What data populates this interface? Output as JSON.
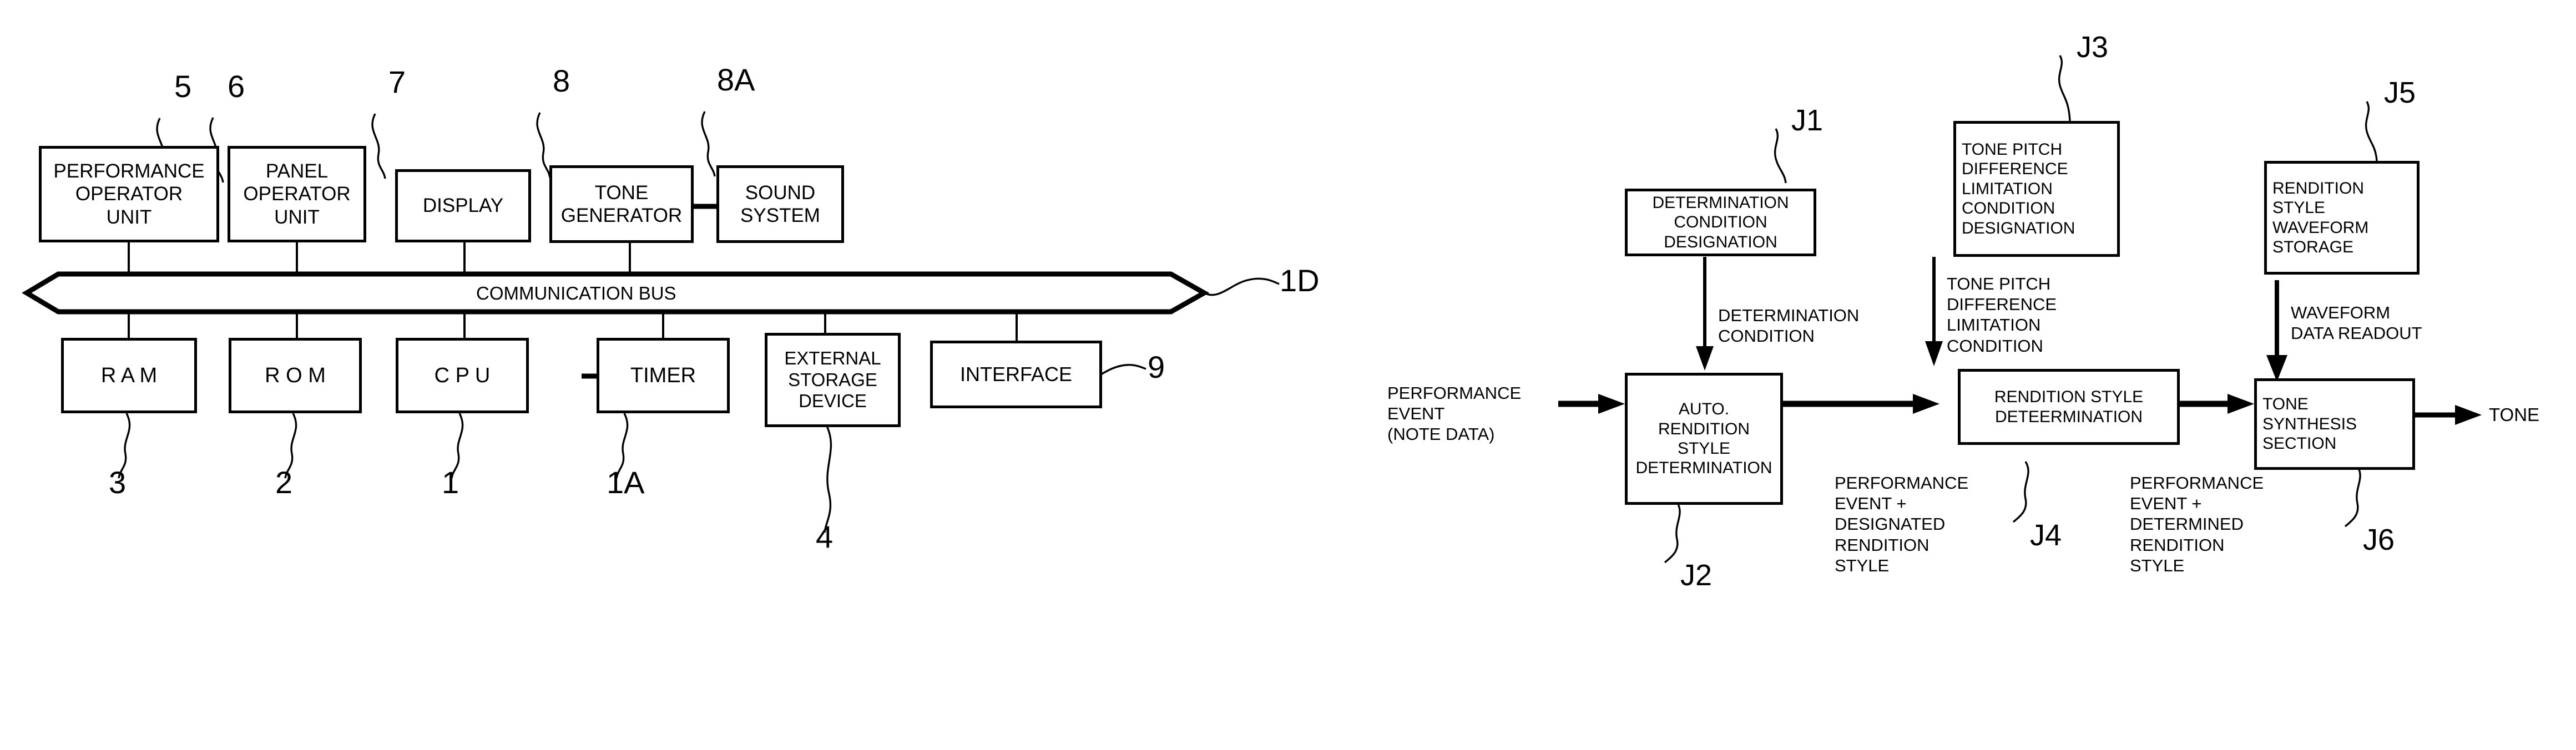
{
  "figure_left": {
    "id": "fig-1-hardware-block-diagram",
    "bus": {
      "label": "COMMUNICATION BUS",
      "ref": "1D"
    },
    "top_row": [
      {
        "lines": [
          "PERFORMANCE",
          "OPERATOR",
          "UNIT"
        ],
        "ref": "5"
      },
      {
        "lines": [
          "PANEL",
          "OPERATOR",
          "UNIT"
        ],
        "ref": "6"
      },
      {
        "lines": [
          "DISPLAY"
        ],
        "ref": "7"
      },
      {
        "lines": [
          "TONE",
          "GENERATOR"
        ],
        "ref": "8"
      },
      {
        "lines": [
          "SOUND",
          "SYSTEM"
        ],
        "ref": "8A"
      }
    ],
    "bottom_row": [
      {
        "lines": [
          "R A M"
        ],
        "ref": "3"
      },
      {
        "lines": [
          "R O M"
        ],
        "ref": "2"
      },
      {
        "lines": [
          "C P U"
        ],
        "ref": "1"
      },
      {
        "lines": [
          "TIMER"
        ],
        "ref": "1A"
      },
      {
        "lines": [
          "EXTERNAL",
          "STORAGE",
          "DEVICE"
        ],
        "ref": "4"
      },
      {
        "lines": [
          "INTERFACE"
        ],
        "ref": "9"
      }
    ]
  },
  "figure_right": {
    "id": "fig-2-functional-flow-diagram",
    "input_label": {
      "lines": [
        "PERFORMANCE",
        "EVENT",
        "(NOTE DATA)"
      ]
    },
    "output_label": "TONE",
    "boxes": [
      {
        "key": "j1",
        "lines": [
          "DETERMINATION",
          "CONDITION",
          "DESIGNATION"
        ],
        "ref": "J1",
        "align": "center"
      },
      {
        "key": "j3",
        "lines": [
          "TONE PITCH",
          "DIFFERENCE",
          "LIMITATION",
          "CONDITION",
          "DESIGNATION"
        ],
        "ref": "J3",
        "align": "left"
      },
      {
        "key": "j5",
        "lines": [
          "RENDITION",
          "STYLE",
          "WAVEFORM",
          "STORAGE"
        ],
        "ref": "J5",
        "align": "left"
      },
      {
        "key": "j2",
        "lines": [
          "AUTO.",
          "RENDITION",
          "STYLE",
          "DETERMINATION"
        ],
        "ref": "J2",
        "align": "center"
      },
      {
        "key": "j4",
        "lines": [
          "RENDITION STYLE",
          "DETEERMINATION"
        ],
        "ref": "J4",
        "align": "center"
      },
      {
        "key": "j6",
        "lines": [
          "TONE",
          "SYNTHESIS",
          "SECTION"
        ],
        "ref": "J6",
        "align": "left"
      }
    ],
    "edge_labels": [
      {
        "key": "determination_condition",
        "lines": [
          "DETERMINATION",
          "CONDITION"
        ]
      },
      {
        "key": "tone_pitch_difference_limitation_condition",
        "lines": [
          "TONE PITCH",
          "DIFFERENCE",
          "LIMITATION",
          "CONDITION"
        ]
      },
      {
        "key": "waveform_data_readout",
        "lines": [
          "WAVEFORM",
          "DATA READOUT"
        ]
      },
      {
        "key": "event_plus_designated_style",
        "lines": [
          "PERFORMANCE",
          "EVENT +",
          "DESIGNATED",
          "RENDITION",
          "STYLE"
        ]
      },
      {
        "key": "event_plus_determined_style",
        "lines": [
          "PERFORMANCE",
          "EVENT +",
          "DETERMINED",
          "RENDITION",
          "STYLE"
        ]
      }
    ]
  },
  "style": {
    "ink": "#000000",
    "paper": "#ffffff"
  }
}
